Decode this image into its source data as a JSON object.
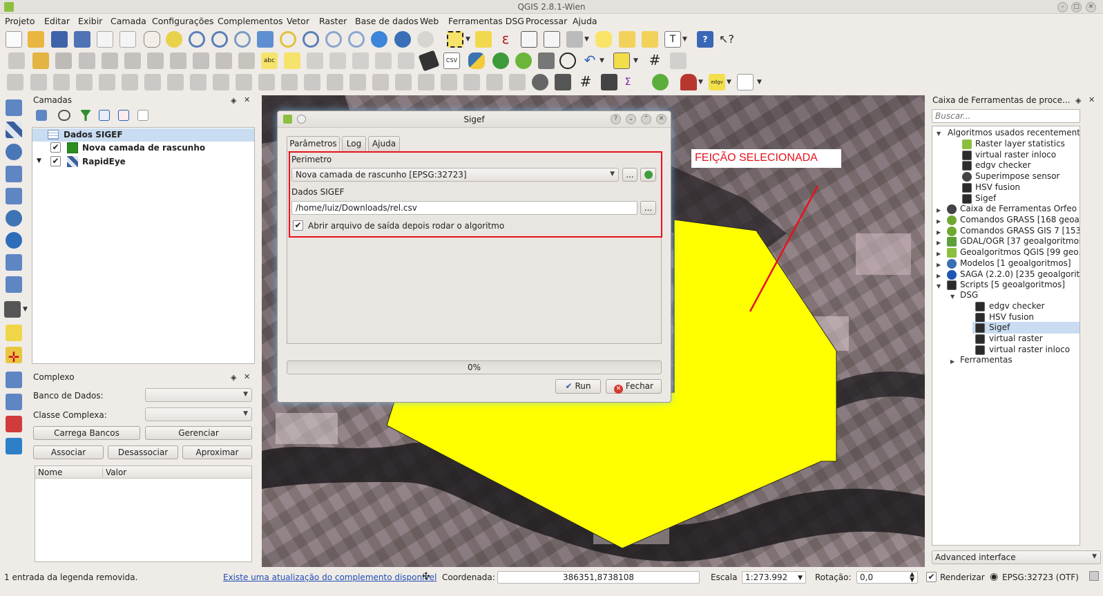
{
  "window": {
    "title": "QGIS 2.8.1-Wien"
  },
  "menu": [
    "Projeto",
    "Editar",
    "Exibir",
    "Camada",
    "Configurações",
    "Complementos",
    "Vetor",
    "Raster",
    "Base de dados",
    "Web",
    "Ferramentas DSG",
    "Processar",
    "Ajuda"
  ],
  "toolbar": {
    "edgv_label": "edgv",
    "csv_label": "CSV",
    "abc_label": "abc"
  },
  "layers_panel": {
    "title": "Camadas",
    "items": [
      {
        "label": "Dados SIGEF",
        "selected": true,
        "checked": false
      },
      {
        "label": "Nova camada de rascunho",
        "checked": true,
        "color": "#2a8f1e"
      },
      {
        "label": "RapidEye",
        "checked": true
      }
    ]
  },
  "complexo_panel": {
    "title": "Complexo",
    "banco_label": "Banco de Dados:",
    "classe_label": "Classe Complexa:",
    "buttons": [
      "Carrega Bancos",
      "Gerenciar",
      "Associar",
      "Desassociar",
      "Aproximar"
    ],
    "table_headers": [
      "Nome",
      "Valor"
    ]
  },
  "map": {
    "annotation": "FEIÇÃO SELECIONADA",
    "polygon_color": "#ffff00",
    "annotation_color": "#e8111b"
  },
  "dialog": {
    "title": "Sigef",
    "tabs": [
      "Parâmetros",
      "Log",
      "Ajuda"
    ],
    "perimetro_label": "Perimetro",
    "perimetro_value": "Nova camada de rascunho [EPSG:32723]",
    "dados_label": "Dados SIGEF",
    "dados_value": "/home/luiz/Downloads/rel.csv",
    "checkbox_label": "Abrir arquivo de saída depois rodar o algoritmo",
    "browse_label": "...",
    "progress_text": "0%",
    "run_label": "Run",
    "close_label": "Fechar"
  },
  "processing": {
    "title": "Caixa de Ferramentas de proce...",
    "search_placeholder": "Buscar...",
    "recent_title": "Algoritmos usados recentemente",
    "recent": [
      "Raster layer statistics",
      "virtual raster inloco",
      "edgv checker",
      "Superimpose sensor",
      "HSV fusion",
      "Sigef"
    ],
    "providers": [
      "Caixa de Ferramentas Orfeo ...",
      "Comandos GRASS [168 geoal...",
      "Comandos GRASS GIS 7 [153 ...",
      "GDAL/OGR [37 geoalgoritmos]",
      "Geoalgoritmos QGIS [99 geo...",
      "Modelos [1 geoalgoritmos]",
      "SAGA (2.2.0) [235 geoalgorit...",
      "Scripts [5 geoalgoritmos]"
    ],
    "dsg_label": "DSG",
    "scripts": [
      "edgv checker",
      "HSV fusion",
      "Sigef",
      "virtual raster",
      "virtual raster inloco"
    ],
    "ferramentas_label": "Ferramentas",
    "interface": "Advanced interface"
  },
  "status": {
    "message": "1 entrada da legenda removida.",
    "update_link": "Existe uma atualização do complemento disponível",
    "coord_label": "Coordenada:",
    "coord_value": "386351,8738108",
    "scale_label": "Escala",
    "scale_value": "1:273.992",
    "rotation_label": "Rotação:",
    "rotation_value": "0,0",
    "render_label": "Renderizar",
    "crs": "EPSG:32723 (OTF)"
  }
}
